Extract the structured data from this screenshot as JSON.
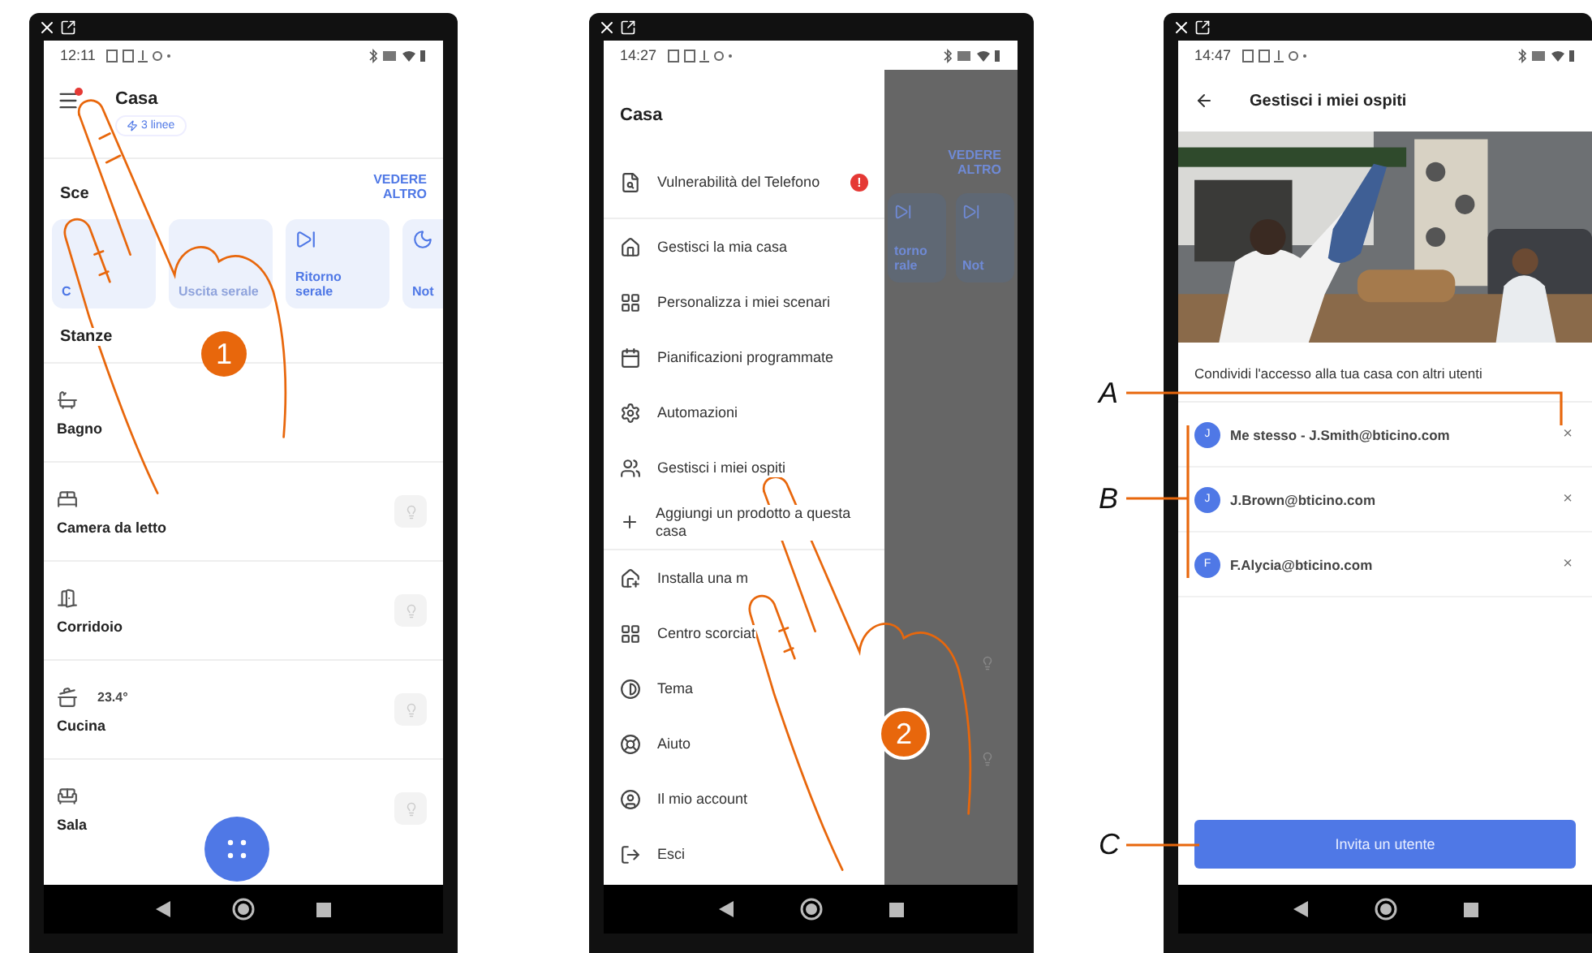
{
  "screen_home": {
    "status_time": "12:11",
    "title": "Casa",
    "lines_badge": "3 linee",
    "menu_alert": true,
    "scenes_label": "Sce",
    "see_more": "VEDERE ALTRO",
    "scenes": [
      {
        "label": "C",
        "disabled": false
      },
      {
        "label": "Uscita serale",
        "disabled": true
      },
      {
        "label": "Ritorno serale",
        "disabled": false
      },
      {
        "label": "Not",
        "disabled": false
      }
    ],
    "rooms_label": "Stanze",
    "rooms": [
      {
        "name": "Bagno",
        "lamp": false
      },
      {
        "name": "Camera da letto",
        "lamp": true
      },
      {
        "name": "Corridoio",
        "lamp": true
      },
      {
        "name": "Cucina",
        "temperature": "23.4°",
        "lamp": true
      },
      {
        "name": "Sala",
        "lamp": true
      }
    ],
    "step": "1"
  },
  "screen_menu": {
    "status_time": "14:27",
    "title": "Casa",
    "items": [
      {
        "label": "Vulnerabilità del Telefono",
        "badge": "!",
        "divider_after": true
      },
      {
        "label": "Gestisci la mia casa",
        "divider_after": false
      },
      {
        "label": "Personalizza i miei scenari",
        "divider_after": false
      },
      {
        "label": "Pianificazioni programmate",
        "divider_after": false
      },
      {
        "label": "Automazioni",
        "divider_after": false
      },
      {
        "label": "Gestisci i miei ospiti",
        "divider_after": false
      },
      {
        "label": "Aggiungi un prodotto a questa casa",
        "divider_after": true
      },
      {
        "label": "Installa una m",
        "divider_after": false
      },
      {
        "label": "Centro scorciat",
        "divider_after": false
      },
      {
        "label": "Tema",
        "divider_after": false
      },
      {
        "label": "Aiuto",
        "divider_after": false
      },
      {
        "label": "Il mio account",
        "divider_after": false
      },
      {
        "label": "Esci",
        "divider_after": false
      }
    ],
    "behind": {
      "see_more": "VEDERE ALTRO",
      "scenes": [
        "torno rale",
        "Not"
      ]
    },
    "step": "2"
  },
  "screen_guests": {
    "status_time": "14:47",
    "title": "Gestisci i miei ospiti",
    "intro": "Condividi l'accesso alla tua casa con altri utenti",
    "guests": [
      {
        "initial": "J",
        "label": "Me stesso - J.Smith@bticino.com",
        "remove": "×"
      },
      {
        "initial": "J",
        "label": "J.Brown@bticino.com",
        "remove": "×"
      },
      {
        "initial": "F",
        "label": "F.Alycia@bticino.com",
        "remove": "×"
      }
    ],
    "invite_button": "Invita un utente"
  },
  "callouts": [
    {
      "label": "A"
    },
    {
      "label": "B"
    },
    {
      "label": "C"
    }
  ]
}
